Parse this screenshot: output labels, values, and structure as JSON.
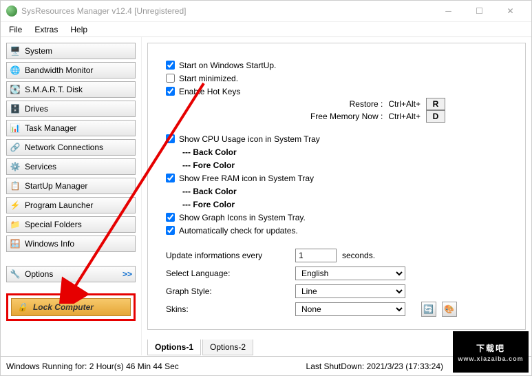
{
  "window": {
    "title": "SysResources Manager  v12.4  [Unregistered]"
  },
  "menu": {
    "file": "File",
    "extras": "Extras",
    "help": "Help"
  },
  "nav": {
    "system": "System",
    "bandwidth": "Bandwidth Monitor",
    "smart": "S.M.A.R.T. Disk",
    "drives": "Drives",
    "taskmgr": "Task Manager",
    "network": "Network Connections",
    "services": "Services",
    "startup": "StartUp Manager",
    "launcher": "Program Launcher",
    "folders": "Special Folders",
    "wininfo": "Windows Info",
    "options": "Options",
    "lock": "Lock Computer",
    "arrow": ">>"
  },
  "opts": {
    "startOnStartup": "Start on Windows StartUp.",
    "startMinimized": "Start minimized.",
    "enableHotkeys": "Enable Hot Keys",
    "restore": "Restore :",
    "freeMem": "Free Memory Now :",
    "combo": "Ctrl+Alt+",
    "keyR": "R",
    "keyD": "D",
    "showCpu": "Show CPU Usage icon in System Tray",
    "backColor": "--- Back Color",
    "foreColor": "--- Fore Color",
    "showRam": "Show Free RAM icon in System Tray",
    "showGraph": "Show Graph Icons in System Tray.",
    "autoUpdate": "Automatically check for updates.",
    "updateEvery": "Update informations every",
    "updateVal": "1",
    "seconds": "seconds.",
    "selectLang": "Select Language:",
    "lang": "English",
    "graphStyle": "Graph Style:",
    "style": "Line",
    "skins": "Skins:",
    "skin": "None"
  },
  "tabs": {
    "t1": "Options-1",
    "t2": "Options-2"
  },
  "status": {
    "left": "Windows Running for: 2 Hour(s) 46 Min 44 Sec",
    "right": "Last ShutDown: 2021/3/23 (17:33:24)"
  },
  "watermark": {
    "big": "下载吧",
    "small": "www.xiazaiba.com"
  }
}
